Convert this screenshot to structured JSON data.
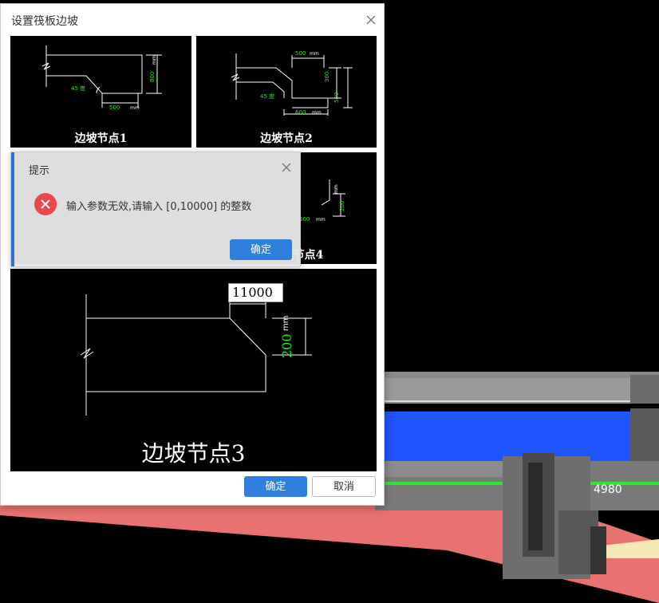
{
  "dialog": {
    "title": "设置筏板边坡",
    "close_icon": "close-icon",
    "panels": [
      {
        "caption": "边坡节点1",
        "angle_label": "45",
        "angle_unit": "度",
        "height_label": "800",
        "width_label": "500",
        "unit": "mm"
      },
      {
        "caption": "边坡节点2",
        "angle_label": "45",
        "angle_unit": "度",
        "top_width_label": "500",
        "mid_height_label": "300",
        "height_label": "500",
        "width_label": "600",
        "unit": "mm"
      },
      {
        "caption": "边坡节点4",
        "height_label": "200",
        "width_label": "300",
        "unit": "mm"
      }
    ],
    "preview": {
      "caption": "边坡节点3",
      "width_input_value": "11000",
      "height_label": "200",
      "unit": "mm"
    },
    "ok_label": "确定",
    "cancel_label": "取消"
  },
  "alert": {
    "title": "提示",
    "message": "输入参数无效,请输入 [0,10000] 的整数",
    "icon": "error-icon",
    "close_icon": "close-icon",
    "ok_label": "确定"
  },
  "background": {
    "dimension_text": "4980",
    "colors": {
      "floor": "#e87272",
      "slab_blue": "#1f54ff",
      "green_line": "#2ee82e",
      "gray": "#7a7a7a"
    }
  }
}
